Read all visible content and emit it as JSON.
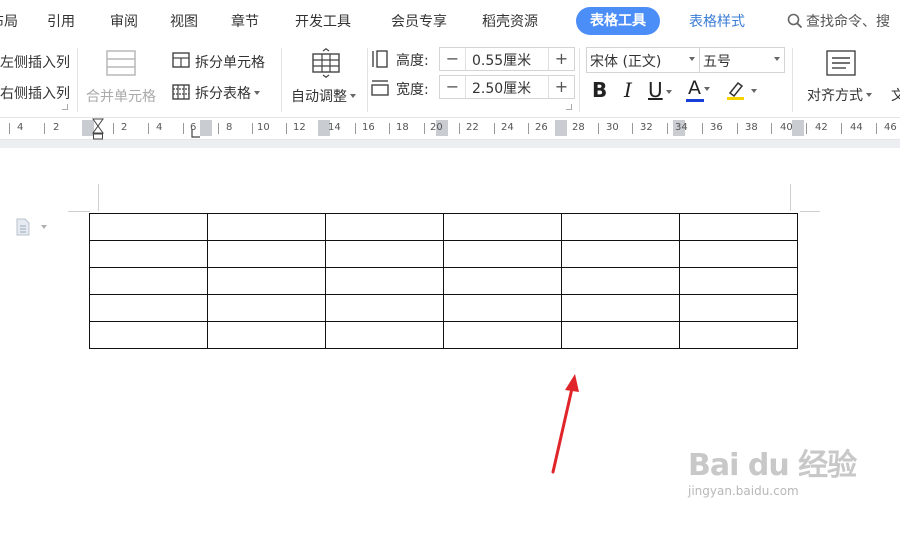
{
  "menu": {
    "tabs": [
      "布局",
      "引用",
      "审阅",
      "视图",
      "章节",
      "开发工具",
      "会员专享",
      "稻壳资源",
      "表格工具",
      "表格样式"
    ],
    "active_tab": "表格工具",
    "search_text": "查找命令、搜"
  },
  "ribbon": {
    "insert_left_col": "在左侧插入列",
    "insert_right_col": "在右侧插入列",
    "merge_cells": "合并单元格",
    "split_cells": "拆分单元格",
    "split_table": "拆分表格",
    "auto_fit": "自动调整",
    "height_label": "高度:",
    "height_value": "0.55厘米",
    "width_label": "宽度:",
    "width_value": "2.50厘米",
    "font_name": "宋体 (正文)",
    "font_size": "五号",
    "bold": "B",
    "italic": "I",
    "underline": "U",
    "font_color": "A",
    "align": "对齐方式",
    "text_dir": "文"
  },
  "ruler": {
    "labels": [
      "4",
      "2",
      "2",
      "4",
      "6",
      "8",
      "10",
      "12",
      "14",
      "16",
      "18",
      "20",
      "22",
      "24",
      "26",
      "28",
      "30",
      "32",
      "34",
      "36",
      "38",
      "40",
      "42",
      "44",
      "46"
    ]
  },
  "table": {
    "rows": 5,
    "cols": 6
  },
  "watermark": {
    "brand": "Bai du 经验",
    "url": "jingyan.baidu.com"
  },
  "colors": {
    "accent": "#4b8ef7",
    "arrow": "#e0252a",
    "font_color_bar": "#1a3fd6",
    "highlight_bar": "#f5d400"
  }
}
